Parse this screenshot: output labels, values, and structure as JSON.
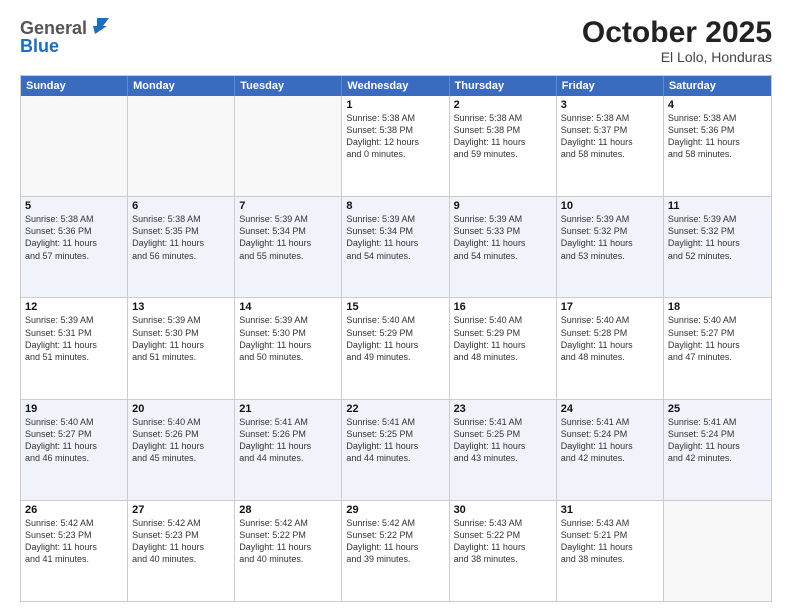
{
  "header": {
    "logo_line1": "General",
    "logo_line2": "Blue",
    "month": "October 2025",
    "location": "El Lolo, Honduras"
  },
  "days_of_week": [
    "Sunday",
    "Monday",
    "Tuesday",
    "Wednesday",
    "Thursday",
    "Friday",
    "Saturday"
  ],
  "rows": [
    [
      {
        "day": "",
        "info": ""
      },
      {
        "day": "",
        "info": ""
      },
      {
        "day": "",
        "info": ""
      },
      {
        "day": "1",
        "info": "Sunrise: 5:38 AM\nSunset: 5:38 PM\nDaylight: 12 hours\nand 0 minutes."
      },
      {
        "day": "2",
        "info": "Sunrise: 5:38 AM\nSunset: 5:38 PM\nDaylight: 11 hours\nand 59 minutes."
      },
      {
        "day": "3",
        "info": "Sunrise: 5:38 AM\nSunset: 5:37 PM\nDaylight: 11 hours\nand 58 minutes."
      },
      {
        "day": "4",
        "info": "Sunrise: 5:38 AM\nSunset: 5:36 PM\nDaylight: 11 hours\nand 58 minutes."
      }
    ],
    [
      {
        "day": "5",
        "info": "Sunrise: 5:38 AM\nSunset: 5:36 PM\nDaylight: 11 hours\nand 57 minutes."
      },
      {
        "day": "6",
        "info": "Sunrise: 5:38 AM\nSunset: 5:35 PM\nDaylight: 11 hours\nand 56 minutes."
      },
      {
        "day": "7",
        "info": "Sunrise: 5:39 AM\nSunset: 5:34 PM\nDaylight: 11 hours\nand 55 minutes."
      },
      {
        "day": "8",
        "info": "Sunrise: 5:39 AM\nSunset: 5:34 PM\nDaylight: 11 hours\nand 54 minutes."
      },
      {
        "day": "9",
        "info": "Sunrise: 5:39 AM\nSunset: 5:33 PM\nDaylight: 11 hours\nand 54 minutes."
      },
      {
        "day": "10",
        "info": "Sunrise: 5:39 AM\nSunset: 5:32 PM\nDaylight: 11 hours\nand 53 minutes."
      },
      {
        "day": "11",
        "info": "Sunrise: 5:39 AM\nSunset: 5:32 PM\nDaylight: 11 hours\nand 52 minutes."
      }
    ],
    [
      {
        "day": "12",
        "info": "Sunrise: 5:39 AM\nSunset: 5:31 PM\nDaylight: 11 hours\nand 51 minutes."
      },
      {
        "day": "13",
        "info": "Sunrise: 5:39 AM\nSunset: 5:30 PM\nDaylight: 11 hours\nand 51 minutes."
      },
      {
        "day": "14",
        "info": "Sunrise: 5:39 AM\nSunset: 5:30 PM\nDaylight: 11 hours\nand 50 minutes."
      },
      {
        "day": "15",
        "info": "Sunrise: 5:40 AM\nSunset: 5:29 PM\nDaylight: 11 hours\nand 49 minutes."
      },
      {
        "day": "16",
        "info": "Sunrise: 5:40 AM\nSunset: 5:29 PM\nDaylight: 11 hours\nand 48 minutes."
      },
      {
        "day": "17",
        "info": "Sunrise: 5:40 AM\nSunset: 5:28 PM\nDaylight: 11 hours\nand 48 minutes."
      },
      {
        "day": "18",
        "info": "Sunrise: 5:40 AM\nSunset: 5:27 PM\nDaylight: 11 hours\nand 47 minutes."
      }
    ],
    [
      {
        "day": "19",
        "info": "Sunrise: 5:40 AM\nSunset: 5:27 PM\nDaylight: 11 hours\nand 46 minutes."
      },
      {
        "day": "20",
        "info": "Sunrise: 5:40 AM\nSunset: 5:26 PM\nDaylight: 11 hours\nand 45 minutes."
      },
      {
        "day": "21",
        "info": "Sunrise: 5:41 AM\nSunset: 5:26 PM\nDaylight: 11 hours\nand 44 minutes."
      },
      {
        "day": "22",
        "info": "Sunrise: 5:41 AM\nSunset: 5:25 PM\nDaylight: 11 hours\nand 44 minutes."
      },
      {
        "day": "23",
        "info": "Sunrise: 5:41 AM\nSunset: 5:25 PM\nDaylight: 11 hours\nand 43 minutes."
      },
      {
        "day": "24",
        "info": "Sunrise: 5:41 AM\nSunset: 5:24 PM\nDaylight: 11 hours\nand 42 minutes."
      },
      {
        "day": "25",
        "info": "Sunrise: 5:41 AM\nSunset: 5:24 PM\nDaylight: 11 hours\nand 42 minutes."
      }
    ],
    [
      {
        "day": "26",
        "info": "Sunrise: 5:42 AM\nSunset: 5:23 PM\nDaylight: 11 hours\nand 41 minutes."
      },
      {
        "day": "27",
        "info": "Sunrise: 5:42 AM\nSunset: 5:23 PM\nDaylight: 11 hours\nand 40 minutes."
      },
      {
        "day": "28",
        "info": "Sunrise: 5:42 AM\nSunset: 5:22 PM\nDaylight: 11 hours\nand 40 minutes."
      },
      {
        "day": "29",
        "info": "Sunrise: 5:42 AM\nSunset: 5:22 PM\nDaylight: 11 hours\nand 39 minutes."
      },
      {
        "day": "30",
        "info": "Sunrise: 5:43 AM\nSunset: 5:22 PM\nDaylight: 11 hours\nand 38 minutes."
      },
      {
        "day": "31",
        "info": "Sunrise: 5:43 AM\nSunset: 5:21 PM\nDaylight: 11 hours\nand 38 minutes."
      },
      {
        "day": "",
        "info": ""
      }
    ]
  ],
  "row_alt": [
    false,
    true,
    false,
    true,
    false
  ]
}
